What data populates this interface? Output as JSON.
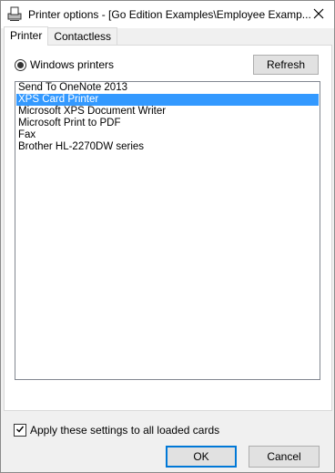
{
  "window": {
    "title": "Printer options - [Go Edition Examples\\Employee Examp...",
    "icons": {
      "app": "printer-icon",
      "close": "close-icon"
    }
  },
  "tabs": [
    {
      "label": "Printer",
      "active": true
    },
    {
      "label": "Contactless",
      "active": false
    }
  ],
  "printer_panel": {
    "radio_label": "Windows printers",
    "radio_selected": true,
    "refresh_label": "Refresh",
    "printers": [
      "Send To OneNote 2013",
      "XPS Card Printer",
      "Microsoft XPS Document Writer",
      "Microsoft Print to PDF",
      "Fax",
      "Brother HL-2270DW series"
    ],
    "selected_printer": "XPS Card Printer"
  },
  "apply_all": {
    "label": "Apply these settings to all loaded cards",
    "checked": true
  },
  "buttons": {
    "ok": "OK",
    "cancel": "Cancel"
  },
  "colors": {
    "selection": "#3399ff",
    "focus_border": "#0078d7"
  }
}
